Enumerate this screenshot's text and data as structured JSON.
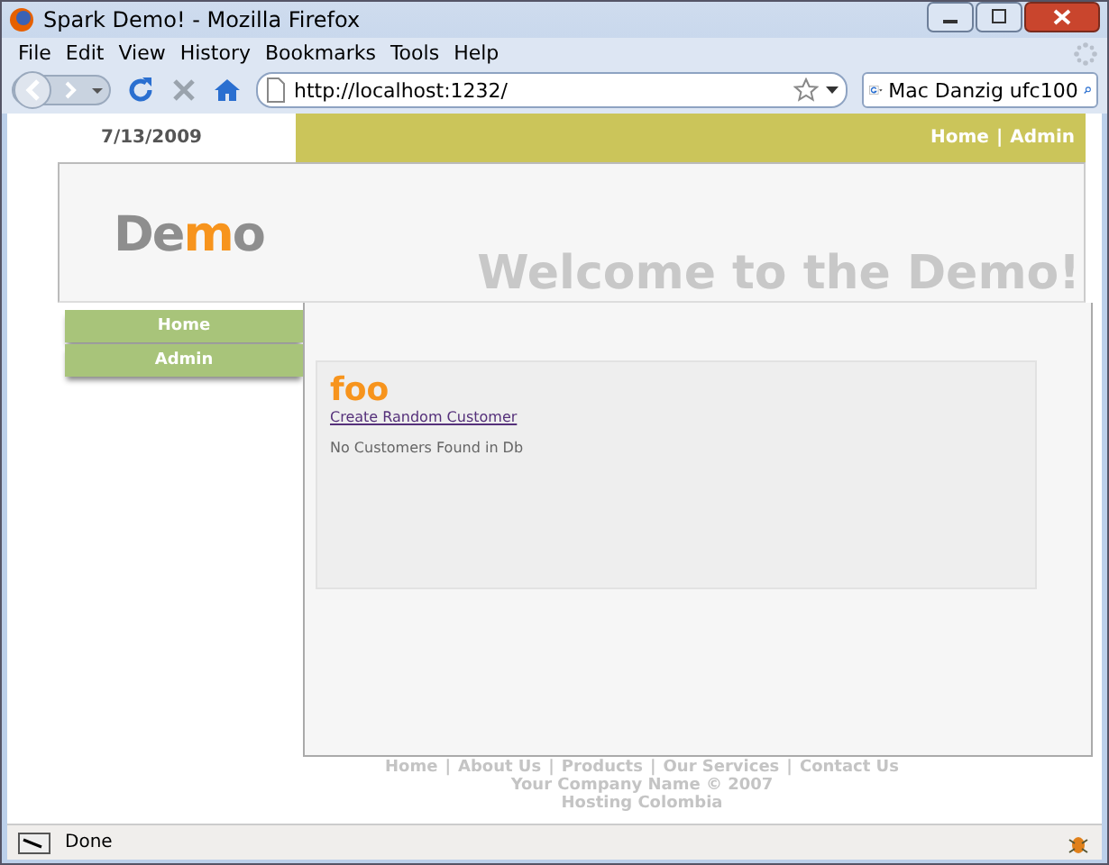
{
  "window": {
    "title": "Spark Demo! - Mozilla Firefox"
  },
  "menu": [
    "File",
    "Edit",
    "View",
    "History",
    "Bookmarks",
    "Tools",
    "Help"
  ],
  "address": {
    "value": "http://localhost:1232/"
  },
  "search": {
    "value": "Mac Danzig ufc100"
  },
  "page": {
    "date": "7/13/2009",
    "top_nav": [
      "Home",
      "Admin"
    ],
    "nav_separator": "|",
    "logo": [
      {
        "text": "De",
        "highlight": false
      },
      {
        "text": "m",
        "highlight": true
      },
      {
        "text": "o",
        "highlight": false
      }
    ],
    "welcome": "Welcome to the Demo!",
    "side_menu": [
      "Home",
      "Admin"
    ],
    "content": {
      "heading": "foo",
      "link": "Create Random Customer",
      "message": "No Customers Found in Db"
    },
    "footer": {
      "links": [
        "Home",
        "About Us",
        "Products",
        "Our Services",
        "Contact Us"
      ],
      "separator": "|",
      "copyright": "Your Company Name © 2007",
      "credit": "Hosting Colombia"
    }
  },
  "status_bar": {
    "text": "Done"
  }
}
